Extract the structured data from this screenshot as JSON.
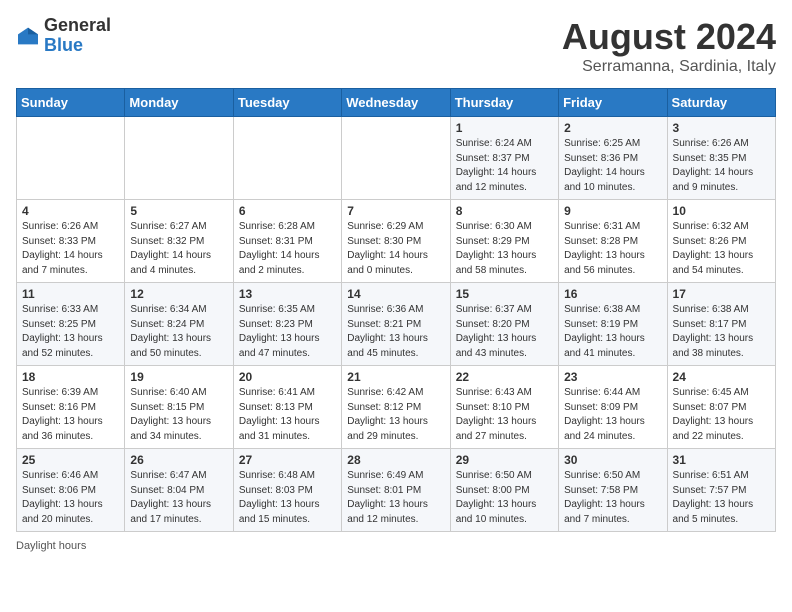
{
  "header": {
    "logo_general": "General",
    "logo_blue": "Blue",
    "title": "August 2024",
    "subtitle": "Serramanna, Sardinia, Italy"
  },
  "days_of_week": [
    "Sunday",
    "Monday",
    "Tuesday",
    "Wednesday",
    "Thursday",
    "Friday",
    "Saturday"
  ],
  "weeks": [
    [
      {
        "day": "",
        "info": ""
      },
      {
        "day": "",
        "info": ""
      },
      {
        "day": "",
        "info": ""
      },
      {
        "day": "",
        "info": ""
      },
      {
        "day": "1",
        "info": "Sunrise: 6:24 AM\nSunset: 8:37 PM\nDaylight: 14 hours\nand 12 minutes."
      },
      {
        "day": "2",
        "info": "Sunrise: 6:25 AM\nSunset: 8:36 PM\nDaylight: 14 hours\nand 10 minutes."
      },
      {
        "day": "3",
        "info": "Sunrise: 6:26 AM\nSunset: 8:35 PM\nDaylight: 14 hours\nand 9 minutes."
      }
    ],
    [
      {
        "day": "4",
        "info": "Sunrise: 6:26 AM\nSunset: 8:33 PM\nDaylight: 14 hours\nand 7 minutes."
      },
      {
        "day": "5",
        "info": "Sunrise: 6:27 AM\nSunset: 8:32 PM\nDaylight: 14 hours\nand 4 minutes."
      },
      {
        "day": "6",
        "info": "Sunrise: 6:28 AM\nSunset: 8:31 PM\nDaylight: 14 hours\nand 2 minutes."
      },
      {
        "day": "7",
        "info": "Sunrise: 6:29 AM\nSunset: 8:30 PM\nDaylight: 14 hours\nand 0 minutes."
      },
      {
        "day": "8",
        "info": "Sunrise: 6:30 AM\nSunset: 8:29 PM\nDaylight: 13 hours\nand 58 minutes."
      },
      {
        "day": "9",
        "info": "Sunrise: 6:31 AM\nSunset: 8:28 PM\nDaylight: 13 hours\nand 56 minutes."
      },
      {
        "day": "10",
        "info": "Sunrise: 6:32 AM\nSunset: 8:26 PM\nDaylight: 13 hours\nand 54 minutes."
      }
    ],
    [
      {
        "day": "11",
        "info": "Sunrise: 6:33 AM\nSunset: 8:25 PM\nDaylight: 13 hours\nand 52 minutes."
      },
      {
        "day": "12",
        "info": "Sunrise: 6:34 AM\nSunset: 8:24 PM\nDaylight: 13 hours\nand 50 minutes."
      },
      {
        "day": "13",
        "info": "Sunrise: 6:35 AM\nSunset: 8:23 PM\nDaylight: 13 hours\nand 47 minutes."
      },
      {
        "day": "14",
        "info": "Sunrise: 6:36 AM\nSunset: 8:21 PM\nDaylight: 13 hours\nand 45 minutes."
      },
      {
        "day": "15",
        "info": "Sunrise: 6:37 AM\nSunset: 8:20 PM\nDaylight: 13 hours\nand 43 minutes."
      },
      {
        "day": "16",
        "info": "Sunrise: 6:38 AM\nSunset: 8:19 PM\nDaylight: 13 hours\nand 41 minutes."
      },
      {
        "day": "17",
        "info": "Sunrise: 6:38 AM\nSunset: 8:17 PM\nDaylight: 13 hours\nand 38 minutes."
      }
    ],
    [
      {
        "day": "18",
        "info": "Sunrise: 6:39 AM\nSunset: 8:16 PM\nDaylight: 13 hours\nand 36 minutes."
      },
      {
        "day": "19",
        "info": "Sunrise: 6:40 AM\nSunset: 8:15 PM\nDaylight: 13 hours\nand 34 minutes."
      },
      {
        "day": "20",
        "info": "Sunrise: 6:41 AM\nSunset: 8:13 PM\nDaylight: 13 hours\nand 31 minutes."
      },
      {
        "day": "21",
        "info": "Sunrise: 6:42 AM\nSunset: 8:12 PM\nDaylight: 13 hours\nand 29 minutes."
      },
      {
        "day": "22",
        "info": "Sunrise: 6:43 AM\nSunset: 8:10 PM\nDaylight: 13 hours\nand 27 minutes."
      },
      {
        "day": "23",
        "info": "Sunrise: 6:44 AM\nSunset: 8:09 PM\nDaylight: 13 hours\nand 24 minutes."
      },
      {
        "day": "24",
        "info": "Sunrise: 6:45 AM\nSunset: 8:07 PM\nDaylight: 13 hours\nand 22 minutes."
      }
    ],
    [
      {
        "day": "25",
        "info": "Sunrise: 6:46 AM\nSunset: 8:06 PM\nDaylight: 13 hours\nand 20 minutes."
      },
      {
        "day": "26",
        "info": "Sunrise: 6:47 AM\nSunset: 8:04 PM\nDaylight: 13 hours\nand 17 minutes."
      },
      {
        "day": "27",
        "info": "Sunrise: 6:48 AM\nSunset: 8:03 PM\nDaylight: 13 hours\nand 15 minutes."
      },
      {
        "day": "28",
        "info": "Sunrise: 6:49 AM\nSunset: 8:01 PM\nDaylight: 13 hours\nand 12 minutes."
      },
      {
        "day": "29",
        "info": "Sunrise: 6:50 AM\nSunset: 8:00 PM\nDaylight: 13 hours\nand 10 minutes."
      },
      {
        "day": "30",
        "info": "Sunrise: 6:50 AM\nSunset: 7:58 PM\nDaylight: 13 hours\nand 7 minutes."
      },
      {
        "day": "31",
        "info": "Sunrise: 6:51 AM\nSunset: 7:57 PM\nDaylight: 13 hours\nand 5 minutes."
      }
    ]
  ],
  "footer": {
    "label": "Daylight hours"
  },
  "colors": {
    "header_bg": "#2979c4",
    "accent": "#2979c4"
  }
}
